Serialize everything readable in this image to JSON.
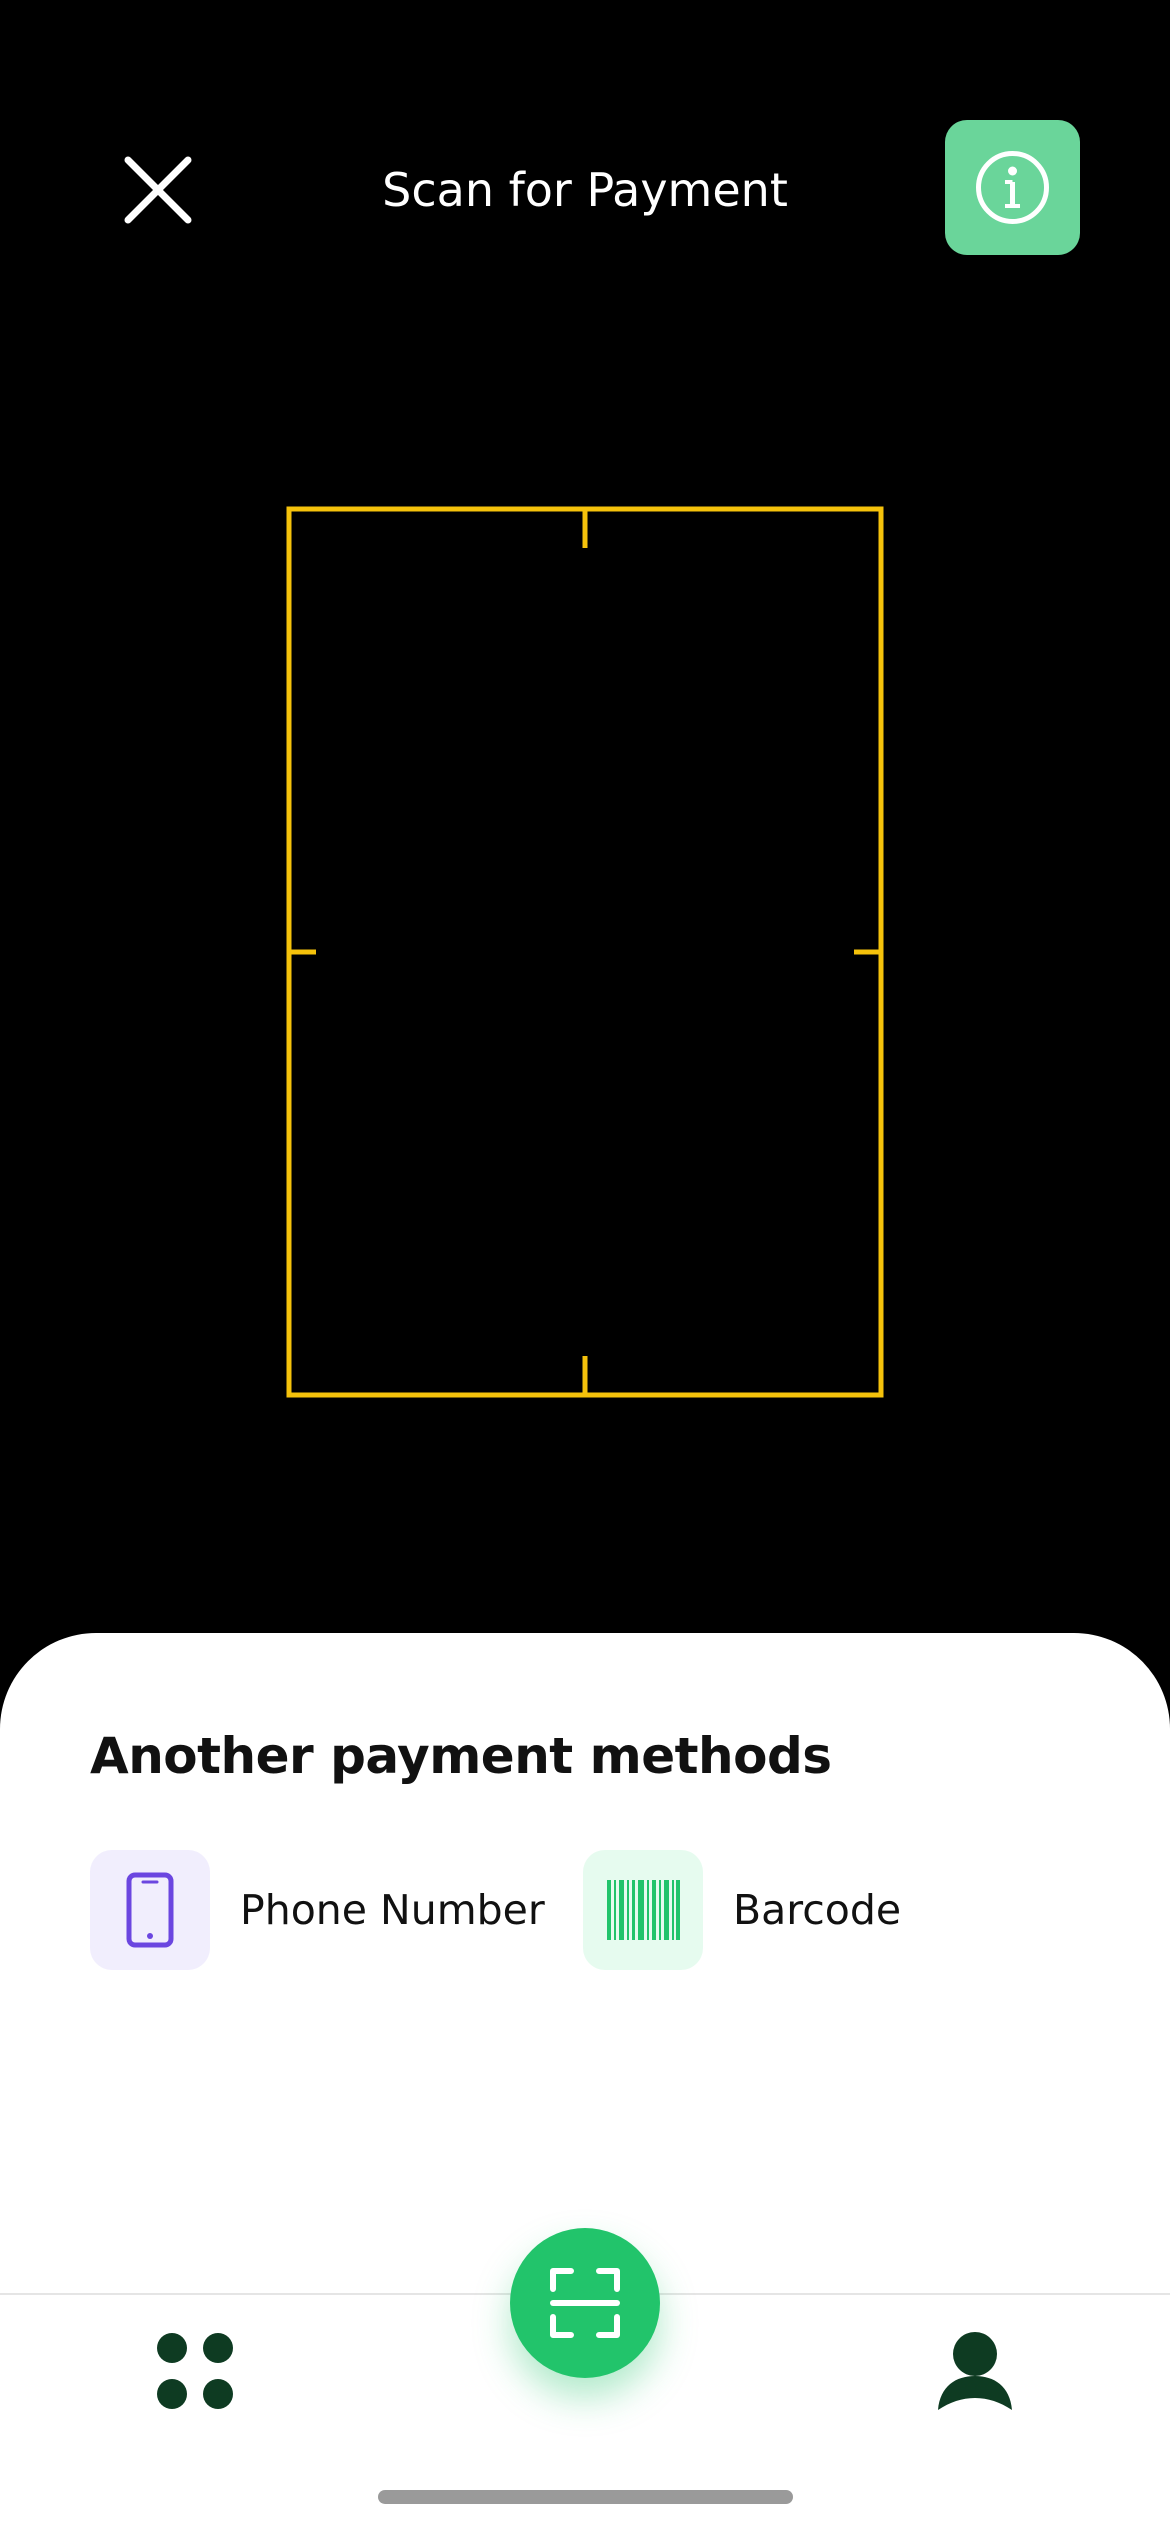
{
  "header": {
    "title": "Scan for Payment",
    "close_icon": "close-icon",
    "info_icon": "info-icon"
  },
  "scanner": {
    "frame_color": "#f5c20b"
  },
  "sheet": {
    "title": "Another payment methods",
    "methods": [
      {
        "label": "Phone Number",
        "icon": "phone-icon",
        "icon_color": "#6b46e0",
        "tile_color": "#f1eefd"
      },
      {
        "label": "Barcode",
        "icon": "barcode-icon",
        "icon_color": "#22c46b",
        "tile_color": "#e6fbef"
      }
    ]
  },
  "nav": {
    "items": [
      {
        "icon": "apps-grid-icon"
      },
      {
        "icon": "scan-icon",
        "active": true
      },
      {
        "icon": "profile-icon"
      }
    ]
  },
  "colors": {
    "accent": "#22c46b",
    "info_button": "#6ad59a",
    "nav_icon": "#0e3b22"
  }
}
